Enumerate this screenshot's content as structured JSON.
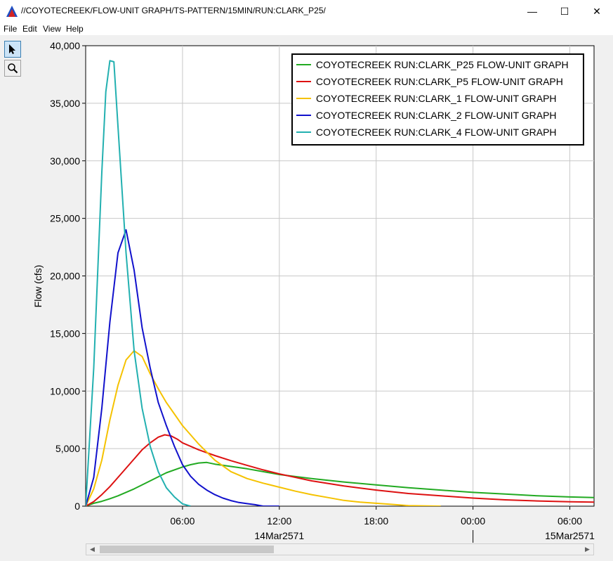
{
  "window": {
    "title": "//COYOTECREEK/FLOW-UNIT GRAPH/TS-PATTERN/15MIN/RUN:CLARK_P25/",
    "minimize_glyph": "—",
    "maximize_glyph": "☐",
    "close_glyph": "✕"
  },
  "menu": [
    "File",
    "Edit",
    "View",
    "Help"
  ],
  "tools": [
    {
      "name": "pointer-icon"
    },
    {
      "name": "zoom-icon"
    }
  ],
  "chart_data": {
    "type": "line",
    "xlabel": "",
    "ylabel": "Flow (cfs)",
    "ylim": [
      0,
      40000
    ],
    "yticks": [
      0,
      5000,
      10000,
      15000,
      20000,
      25000,
      30000,
      35000,
      40000
    ],
    "ytick_labels": [
      "0",
      "5,000",
      "10,000",
      "15,000",
      "20,000",
      "25,000",
      "30,000",
      "35,000",
      "40,000"
    ],
    "x_units": "hours from 14Mar2571 00:00",
    "xlim": [
      0,
      31.5
    ],
    "xticks": [
      6,
      12,
      18,
      24,
      30
    ],
    "xtick_labels": [
      "06:00",
      "12:00",
      "18:00",
      "00:00",
      "06:00"
    ],
    "date_labels": [
      {
        "x": 12,
        "text": "14Mar2571"
      },
      {
        "x": 30,
        "text": "15Mar2571"
      }
    ],
    "day_divider_x": 24,
    "grid": true,
    "legend_position": "top-right",
    "series": [
      {
        "name": "COYOTECREEK RUN:CLARK_P25 FLOW-UNIT GRAPH",
        "color": "#22aa22",
        "x": [
          0,
          0.5,
          1,
          1.5,
          2,
          3,
          4,
          5,
          6,
          6.5,
          7,
          7.5,
          8,
          9,
          10,
          11,
          12,
          14,
          16,
          18,
          20,
          22,
          24,
          26,
          28,
          30,
          31.5
        ],
        "y": [
          0,
          250,
          420,
          650,
          900,
          1500,
          2200,
          2900,
          3400,
          3600,
          3750,
          3800,
          3650,
          3450,
          3250,
          3000,
          2750,
          2400,
          2100,
          1850,
          1600,
          1400,
          1200,
          1050,
          900,
          800,
          750
        ]
      },
      {
        "name": "COYOTECREEK RUN:CLARK_P5 FLOW-UNIT GRAPH",
        "color": "#dd1111",
        "x": [
          0,
          0.5,
          1,
          1.5,
          2,
          2.5,
          3,
          3.5,
          4,
          4.5,
          4.9,
          5.3,
          5.7,
          6,
          7,
          8,
          9,
          10,
          11,
          12,
          14,
          16,
          18,
          20,
          22,
          24,
          26,
          28,
          30,
          31.5
        ],
        "y": [
          0,
          400,
          1000,
          1700,
          2500,
          3300,
          4100,
          4900,
          5500,
          6000,
          6200,
          6100,
          5800,
          5500,
          4900,
          4400,
          3950,
          3550,
          3150,
          2800,
          2200,
          1750,
          1400,
          1100,
          900,
          700,
          550,
          450,
          380,
          350
        ]
      },
      {
        "name": "COYOTECREEK RUN:CLARK_1 FLOW-UNIT GRAPH",
        "color": "#f5c200",
        "x": [
          0,
          0.5,
          1,
          1.5,
          2,
          2.5,
          3,
          3.5,
          4,
          4.5,
          5,
          6,
          7,
          8,
          9,
          10,
          11,
          12,
          13,
          14,
          15,
          16,
          17,
          18,
          19,
          20,
          22
        ],
        "y": [
          0,
          1500,
          4000,
          7500,
          10500,
          12700,
          13500,
          13000,
          11500,
          10200,
          9000,
          7000,
          5400,
          4000,
          3000,
          2400,
          2000,
          1650,
          1300,
          1000,
          750,
          500,
          350,
          250,
          150,
          50,
          0
        ]
      },
      {
        "name": "COYOTECREEK RUN:CLARK_2 FLOW-UNIT GRAPH",
        "color": "#1111cc",
        "x": [
          0,
          0.5,
          1,
          1.5,
          2,
          2.5,
          3,
          3.5,
          4,
          4.5,
          5,
          5.5,
          6,
          6.5,
          7,
          7.5,
          8,
          8.5,
          9,
          9.5,
          10,
          10.5,
          11,
          12
        ],
        "y": [
          0,
          2500,
          8500,
          16000,
          22000,
          24000,
          20500,
          15500,
          12000,
          9000,
          7000,
          5200,
          3600,
          2600,
          1900,
          1400,
          1000,
          700,
          480,
          320,
          220,
          130,
          0,
          0
        ]
      },
      {
        "name": "COYOTECREEK RUN:CLARK_4 FLOW-UNIT GRAPH",
        "color": "#22b0b0",
        "x": [
          0,
          0.5,
          1,
          1.25,
          1.5,
          1.75,
          2,
          2.5,
          3,
          3.5,
          4,
          4.5,
          5,
          5.5,
          6,
          6.5
        ],
        "y": [
          0,
          12000,
          29000,
          36000,
          38700,
          38600,
          33000,
          22000,
          13500,
          8500,
          5200,
          3000,
          1600,
          800,
          200,
          0
        ]
      }
    ]
  }
}
